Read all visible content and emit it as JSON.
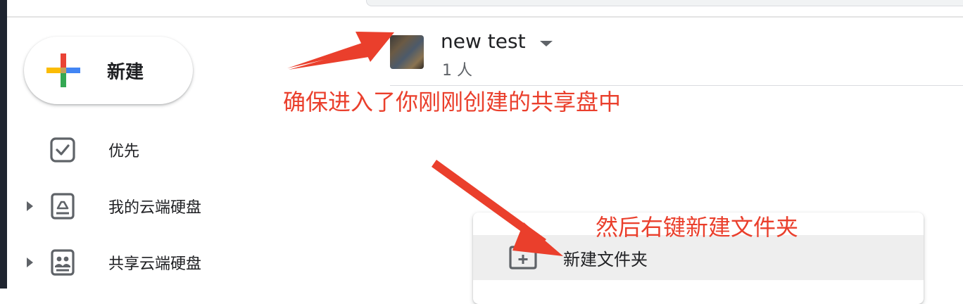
{
  "sidebar": {
    "new_button_label": "新建",
    "items": [
      {
        "label": "优先",
        "icon": "priority-checkbox-icon",
        "expandable": false
      },
      {
        "label": "我的云端硬盘",
        "icon": "my-drive-icon",
        "expandable": true
      },
      {
        "label": "共享云端硬盘",
        "icon": "shared-drives-icon",
        "expandable": true
      }
    ]
  },
  "drive": {
    "name": "new test",
    "members": "1 人"
  },
  "annotations": {
    "top": "确保进入了你刚刚创建的共享盘中",
    "bottom": "然后右键新建文件夹"
  },
  "context_menu": {
    "items": [
      {
        "label": "新建文件夹",
        "icon": "new-folder-icon",
        "highlighted": true
      }
    ]
  },
  "colors": {
    "annotation": "#ea3f2c",
    "plus_red": "#ea4335",
    "plus_blue": "#4285f4",
    "plus_green": "#34a853",
    "plus_yellow": "#fbbc04",
    "icon_gray": "#5f6368"
  }
}
